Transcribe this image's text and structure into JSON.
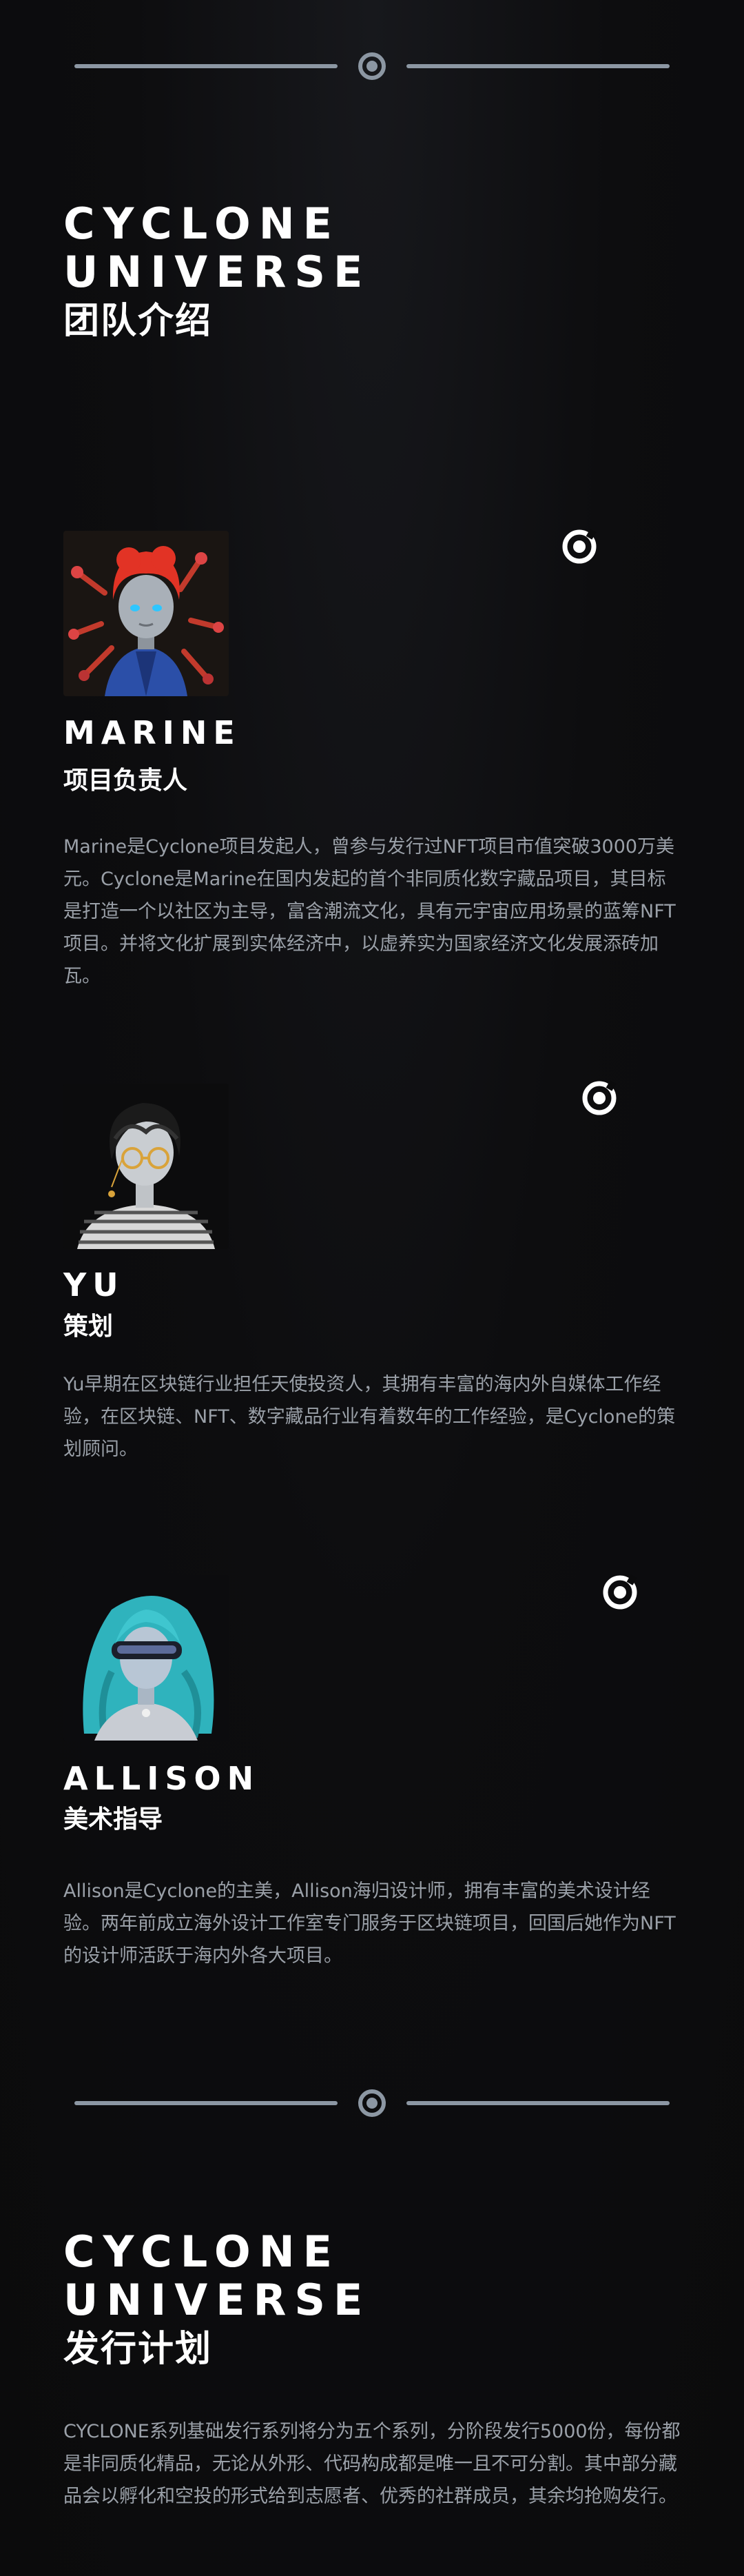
{
  "section1": {
    "title_line1": "CYCLONE",
    "title_line2": "UNIVERSE",
    "subtitle": "团队介绍"
  },
  "members": [
    {
      "name": "MARINE",
      "role": "项目负责人",
      "bio": "Marine是Cyclone项目发起人，曾参与发行过NFT项目市值突破3000万美元。Cyclone是Marine在国内发起的首个非同质化数字藏品项目，其目标是打造一个以社区为主导，富含潮流文化，具有元宇宙应用场景的蓝筹NFT项目。并将文化扩展到实体经济中，以虚养实为国家经济文化发展添砖加瓦。"
    },
    {
      "name": "YU",
      "role": "策划",
      "bio": "Yu早期在区块链行业担任天使投资人，其拥有丰富的海内外自媒体工作经验，在区块链、NFT、数字藏品行业有着数年的工作经验，是Cyclone的策划顾问。"
    },
    {
      "name": "ALLISON",
      "role": "美术指导",
      "bio": "Allison是Cyclone的主美，Allison海归设计师，拥有丰富的美术设计经验。两年前成立海外设计工作室专门服务于区块链项目，回国后她作为NFT的设计师活跃于海内外各大项目。"
    }
  ],
  "section2": {
    "title_line1": "CYCLONE",
    "title_line2": "UNIVERSE",
    "subtitle": "发行计划",
    "body": "CYCLONE系列基础发行系列将分为五个系列，分阶段发行5000份，每份都是非同质化精品，无论从外形、代码构成都是唯一且不可分割。其中部分藏品会以孵化和空投的形式给到志愿者、优秀的社群成员，其余均抢购发行。"
  },
  "colors": {
    "background": "#0b0b0c",
    "divider": "#8c97a3",
    "text": "#ffffff",
    "muted_text": "#9aa0a8"
  },
  "icons": [
    "divider-ring-icon",
    "cyclone-ring-icon",
    "avatar-marine",
    "avatar-yu",
    "avatar-allison"
  ]
}
